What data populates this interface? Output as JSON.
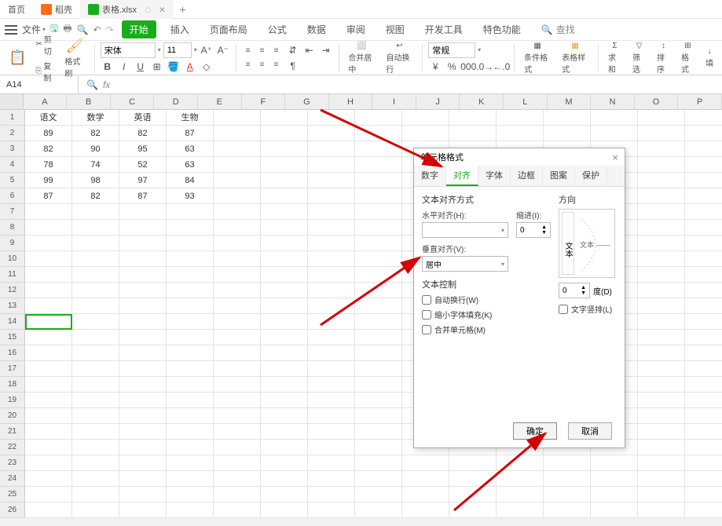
{
  "tabs": {
    "home": "首页",
    "shell": "稻壳",
    "file": "表格.xlsx"
  },
  "menu": {
    "file": "文件",
    "items": [
      "开始",
      "插入",
      "页面布局",
      "公式",
      "数据",
      "审阅",
      "视图",
      "开发工具",
      "特色功能"
    ],
    "search": "查找"
  },
  "ribbon": {
    "cut": "剪切",
    "copy": "复制",
    "fmtpaint": "格式刷",
    "font": "宋体",
    "font_size": "11",
    "merge": "合并居中",
    "wrap": "自动换行",
    "general": "常规",
    "condfmt": "条件格式",
    "tablestyle": "表格样式",
    "sum": "求和",
    "filter": "筛选",
    "sort": "排序",
    "format": "格式",
    "fill": "填"
  },
  "name_box": "A14",
  "columns": [
    "A",
    "B",
    "C",
    "D",
    "E",
    "F",
    "G",
    "H",
    "I",
    "J",
    "K",
    "L",
    "M",
    "N",
    "O",
    "P"
  ],
  "headers": [
    "语文",
    "数学",
    "英语",
    "生物"
  ],
  "rows": [
    [
      "89",
      "82",
      "82",
      "87"
    ],
    [
      "82",
      "90",
      "95",
      "63"
    ],
    [
      "78",
      "74",
      "52",
      "63"
    ],
    [
      "99",
      "98",
      "97",
      "84"
    ],
    [
      "87",
      "82",
      "87",
      "93"
    ]
  ],
  "dialog": {
    "title": "单元格格式",
    "tabs": [
      "数字",
      "对齐",
      "字体",
      "边框",
      "图案",
      "保护"
    ],
    "active_tab": 1,
    "section_align": "文本对齐方式",
    "halign_label": "水平对齐(H):",
    "halign_value": "",
    "valign_label": "垂直对齐(V):",
    "valign_value": "居中",
    "indent_label": "缩进(I):",
    "indent_value": "0",
    "section_control": "文本控制",
    "wrap": "自动换行(W)",
    "shrink": "缩小字体填充(K)",
    "merge": "合并单元格(M)",
    "orient_title": "方向",
    "orient_vert": "文本",
    "orient_word": "文本",
    "degree_label": "度(D)",
    "degree_value": "0",
    "vertical_text": "文字竖排(L)",
    "ok": "确定",
    "cancel": "取消"
  }
}
